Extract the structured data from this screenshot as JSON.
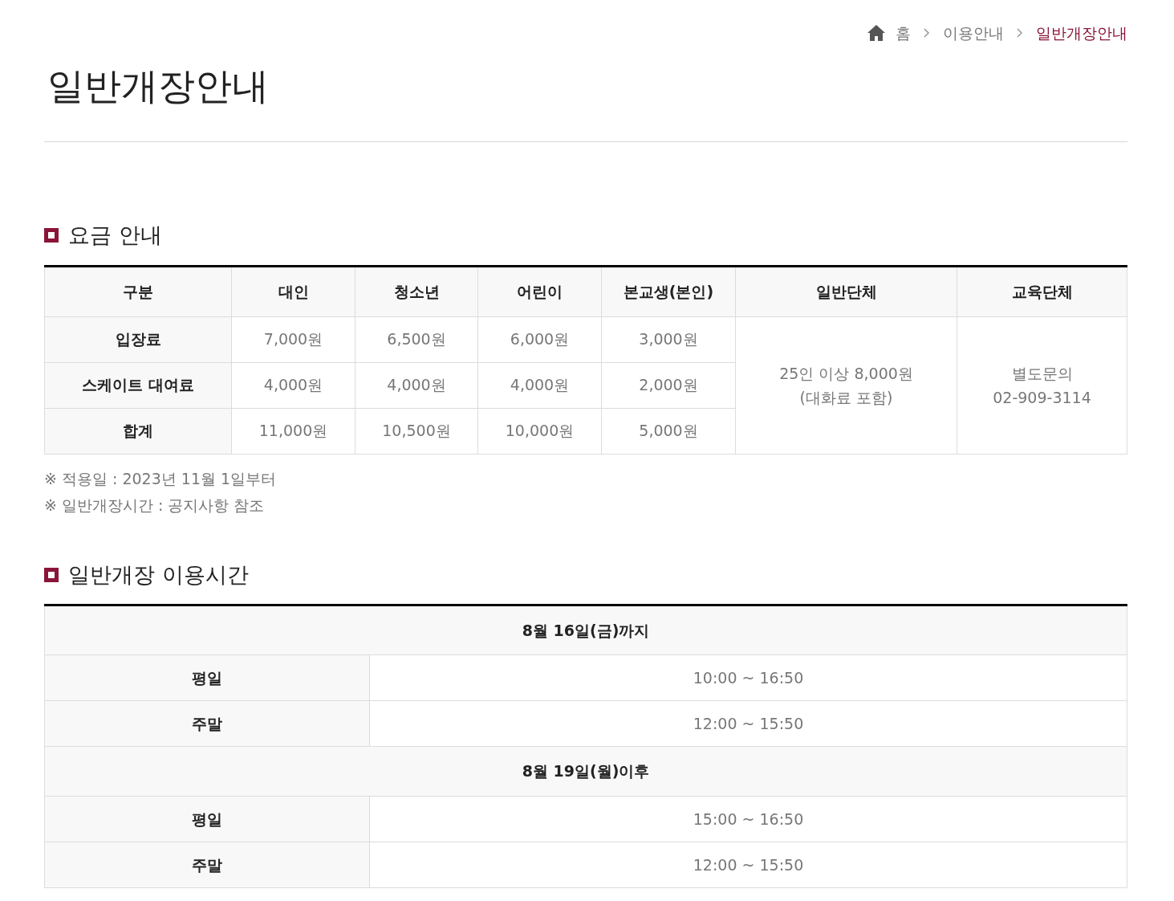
{
  "breadcrumb": [
    {
      "label": "홈",
      "kind": "home",
      "selected": false
    },
    {
      "label": "이용안내",
      "kind": "text",
      "selected": false
    },
    {
      "label": "일반개장안내",
      "kind": "text",
      "selected": true
    }
  ],
  "page_title": "일반개장안내",
  "fee_section": {
    "heading": "요금 안내",
    "columns": [
      "구분",
      "대인",
      "청소년",
      "어린이",
      "본교생(본인)",
      "일반단체",
      "교육단체"
    ],
    "rows": [
      {
        "label": "입장료",
        "values": [
          "7,000원",
          "6,500원",
          "6,000원",
          "3,000원"
        ]
      },
      {
        "label": "스케이트 대여료",
        "values": [
          "4,000원",
          "4,000원",
          "4,000원",
          "2,000원"
        ]
      },
      {
        "label": "합계",
        "values": [
          "11,000원",
          "10,500원",
          "10,000원",
          "5,000원"
        ]
      }
    ],
    "group_cells": [
      {
        "lines": [
          "25인 이상 8,000원",
          "(대화료 포함)"
        ]
      },
      {
        "lines": [
          "별도문의",
          "02-909-3114"
        ]
      }
    ],
    "notes": [
      "※ 적용일 : 2023년 11월 1일부터",
      "※ 일반개장시간 : 공지사항 참조"
    ]
  },
  "hours_section": {
    "heading": "일반개장 이용시간",
    "periods": [
      {
        "title": "8월 16일(금)까지",
        "rows": [
          {
            "label": "평일",
            "time": "10:00 ~ 16:50"
          },
          {
            "label": "주말",
            "time": "12:00 ~ 15:50"
          }
        ]
      },
      {
        "title": "8월 19일(월)이후",
        "rows": [
          {
            "label": "평일",
            "time": "15:00 ~ 16:50"
          },
          {
            "label": "주말",
            "time": "12:00 ~ 15:50"
          }
        ]
      }
    ]
  }
}
